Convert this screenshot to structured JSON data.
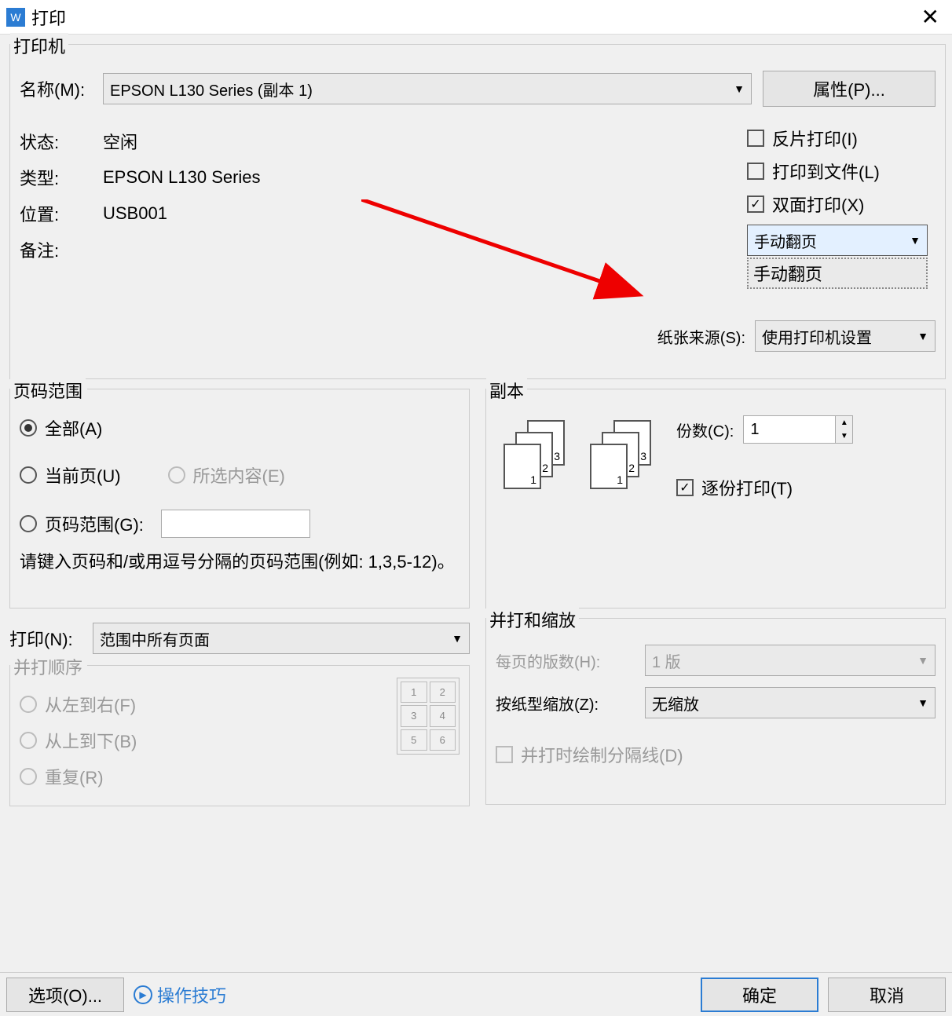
{
  "titlebar": {
    "title": "打印"
  },
  "printer_group": {
    "label": "打印机",
    "name_lbl": "名称(M):",
    "name_val": "EPSON L130 Series (副本 1)",
    "properties_btn": "属性(P)...",
    "status_lbl": "状态:",
    "status_val": "空闲",
    "type_lbl": "类型:",
    "type_val": "EPSON L130 Series",
    "location_lbl": "位置:",
    "location_val": "USB001",
    "comment_lbl": "备注:",
    "mirror_chk": "反片打印(I)",
    "print_to_file_chk": "打印到文件(L)",
    "duplex_chk": "双面打印(X)",
    "duplex_mode": "手动翻页",
    "duplex_dropdown_item": "手动翻页",
    "paper_source_lbl": "纸张来源(S):",
    "paper_source_val": "使用打印机设置"
  },
  "range_group": {
    "label": "页码范围",
    "all": "全部(A)",
    "current": "当前页(U)",
    "selection": "所选内容(E)",
    "range": "页码范围(G):",
    "hint": "请键入页码和/或用逗号分隔的页码范围(例如:  1,3,5-12)。"
  },
  "copies_group": {
    "label": "副本",
    "copies_lbl": "份数(C):",
    "copies_val": "1",
    "collate": "逐份打印(T)"
  },
  "print_what": {
    "lbl": "打印(N):",
    "val": "范围中所有页面"
  },
  "order_group": {
    "label": "并打顺序",
    "ltr": "从左到右(F)",
    "ttb": "从上到下(B)",
    "repeat": "重复(R)"
  },
  "zoom_group": {
    "label": "并打和缩放",
    "pages_per_sheet_lbl": "每页的版数(H):",
    "pages_per_sheet_val": "1 版",
    "scale_lbl": "按纸型缩放(Z):",
    "scale_val": "无缩放",
    "draw_borders": "并打时绘制分隔线(D)"
  },
  "footer": {
    "options": "选项(O)...",
    "tips": "操作技巧",
    "ok": "确定",
    "cancel": "取消"
  }
}
